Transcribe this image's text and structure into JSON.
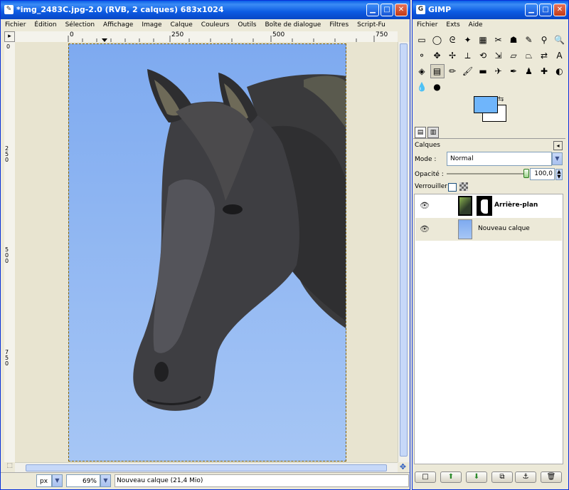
{
  "image_window": {
    "title": "*img_2483C.jpg-2.0 (RVB, 2 calques) 683x1024",
    "menu": [
      "Fichier",
      "Édition",
      "Sélection",
      "Affichage",
      "Image",
      "Calque",
      "Couleurs",
      "Outils",
      "Boîte de dialogue",
      "Filtres",
      "Script-Fu"
    ],
    "ruler_h_labels": [
      "0",
      "250",
      "500",
      "750"
    ],
    "ruler_v_labels": [
      "0",
      "250",
      "500",
      "750"
    ],
    "unit": "px",
    "zoom": "69%",
    "status": "Nouveau calque (21,4 Mio)"
  },
  "gimp_window": {
    "title": "GIMP",
    "menu": [
      "Fichier",
      "Exts",
      "Aide"
    ]
  },
  "toolbox": {
    "tools": [
      {
        "icon": "rect-select-icon",
        "glyph": "▭"
      },
      {
        "icon": "ellipse-select-icon",
        "glyph": "◯"
      },
      {
        "icon": "lasso-icon",
        "glyph": "ᘓ"
      },
      {
        "icon": "magic-wand-icon",
        "glyph": "✦"
      },
      {
        "icon": "select-by-color-icon",
        "glyph": "▦"
      },
      {
        "icon": "scissors-icon",
        "glyph": "✂"
      },
      {
        "icon": "foreground-select-icon",
        "glyph": "☗"
      },
      {
        "icon": "paths-icon",
        "glyph": "✎"
      },
      {
        "icon": "color-picker-icon",
        "glyph": "⚲"
      },
      {
        "icon": "zoom-icon",
        "glyph": "🔍"
      },
      {
        "icon": "measure-icon",
        "glyph": "⚬"
      },
      {
        "icon": "move-icon",
        "glyph": "✥"
      },
      {
        "icon": "align-icon",
        "glyph": "✢"
      },
      {
        "icon": "crop-icon",
        "glyph": "⟂"
      },
      {
        "icon": "rotate-icon",
        "glyph": "⟲"
      },
      {
        "icon": "scale-icon",
        "glyph": "⇲"
      },
      {
        "icon": "shear-icon",
        "glyph": "▱"
      },
      {
        "icon": "perspective-icon",
        "glyph": "⏢"
      },
      {
        "icon": "flip-icon",
        "glyph": "⇄"
      },
      {
        "icon": "text-icon",
        "glyph": "A"
      },
      {
        "icon": "bucket-fill-icon",
        "glyph": "◈"
      },
      {
        "icon": "gradient-icon",
        "glyph": "▤"
      },
      {
        "icon": "pencil-icon",
        "glyph": "✏"
      },
      {
        "icon": "paintbrush-icon",
        "glyph": "🖌"
      },
      {
        "icon": "eraser-icon",
        "glyph": "▬"
      },
      {
        "icon": "airbrush-icon",
        "glyph": "✈"
      },
      {
        "icon": "ink-icon",
        "glyph": "✒"
      },
      {
        "icon": "clone-icon",
        "glyph": "♟"
      },
      {
        "icon": "heal-icon",
        "glyph": "✚"
      },
      {
        "icon": "convolve-icon",
        "glyph": "◐"
      },
      {
        "icon": "smudge-icon",
        "glyph": "💧"
      },
      {
        "icon": "dodge-burn-icon",
        "glyph": "●"
      }
    ],
    "fg_color": "#6fb5fb",
    "bg_color": "#ffffff"
  },
  "layers": {
    "title": "Calques",
    "mode_label": "Mode :",
    "mode_value": "Normal",
    "opacity_label": "Opacité :",
    "opacity_value": "100,0",
    "opacity_fraction": 1.0,
    "lock_label": "Verrouiller :",
    "rows": [
      {
        "name": "Arrière-plan",
        "bold": true,
        "selected": false
      },
      {
        "name": "Nouveau calque",
        "bold": false,
        "selected": true
      }
    ]
  }
}
